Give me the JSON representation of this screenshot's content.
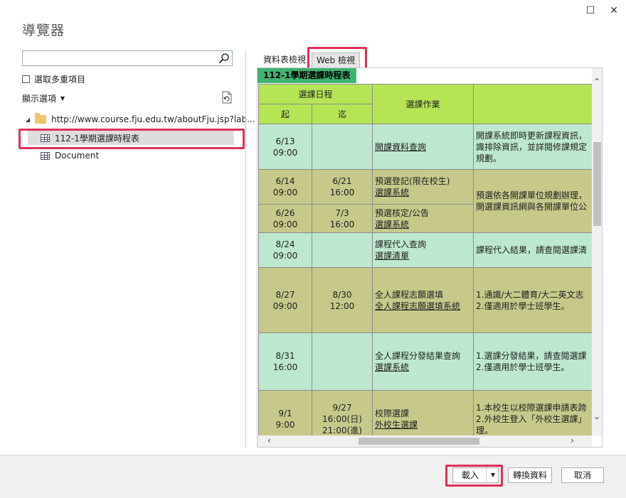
{
  "window": {
    "title": "導覽器",
    "restore_glyph": "☐",
    "close_glyph": "✕"
  },
  "left": {
    "search_placeholder": "",
    "multi_select_label": "選取多重項目",
    "display_options_label": "顯示選項",
    "tree": {
      "root_label": "http://www.course.fju.edu.tw/aboutFju.jsp?lab...",
      "items": [
        {
          "label": "112-1學期選課時程表",
          "selected": true
        },
        {
          "label": "Document",
          "selected": false
        }
      ]
    }
  },
  "right": {
    "tabs": [
      {
        "label": "資料表檢視",
        "active": false
      },
      {
        "label": "Web 檢視",
        "active": true
      }
    ],
    "caption": "112-1學期選課時程表",
    "table": {
      "header": {
        "schedule": "選課日程",
        "start": "起",
        "end": "迄",
        "task": "選課作業",
        "desc": ""
      },
      "rows": [
        {
          "start": [
            "6/13",
            "09:00"
          ],
          "end": [
            "",
            ""
          ],
          "task": [
            "開課資料查詢"
          ],
          "task_links": [
            true
          ],
          "desc": [
            "開課系統即時更新課程資訊，",
            "識排除資訊，並詳閱修課規定",
            "規劃。"
          ],
          "tone": "A"
        },
        {
          "start": [
            "6/14",
            "09:00"
          ],
          "end": [
            "6/21",
            "16:00"
          ],
          "task": [
            "預選登記(限在校生)",
            "選課系統"
          ],
          "task_links": [
            false,
            true
          ],
          "desc": [
            "",
            "預選依各開課單位規劃辦理，",
            "開選課資訊網與各開課單位公"
          ],
          "tone": "B"
        },
        {
          "start": [
            "6/26",
            "09:00"
          ],
          "end": [
            "7/3",
            "16:00"
          ],
          "task": [
            "預選核定/公告",
            "選課系統"
          ],
          "task_links": [
            false,
            true
          ],
          "desc": [],
          "tone": "B"
        },
        {
          "start": [
            "8/24",
            "09:00"
          ],
          "end": [
            "",
            ""
          ],
          "task": [
            "課程代入查詢",
            "選課清單"
          ],
          "task_links": [
            false,
            true
          ],
          "desc": [
            "課程代入結果，請查閱選課清"
          ],
          "tone": "A"
        },
        {
          "start": [
            "8/27",
            "09:00"
          ],
          "end": [
            "8/30",
            "12:00"
          ],
          "task": [
            "全人課程志願選填",
            "全人課程志願選填系統"
          ],
          "task_links": [
            false,
            true
          ],
          "desc": [
            "1.通識/大二體育/大二英文志",
            "2.僅適用於學士班學生。"
          ],
          "tone": "B"
        },
        {
          "start": [
            "8/31",
            "16:00"
          ],
          "end": [
            "",
            ""
          ],
          "task": [
            "全人課程分發結果查詢",
            "選課系統"
          ],
          "task_links": [
            false,
            true
          ],
          "desc": [
            "1.選課分發結果，請查閱選課",
            "2.僅適用於學士班學生。"
          ],
          "tone": "A"
        },
        {
          "start": [
            "9/1",
            "9:00"
          ],
          "end": [
            "9/27",
            "16:00(日)",
            "21:00(進)"
          ],
          "task": [
            "校際選課",
            "外校生選課"
          ],
          "task_links": [
            false,
            true
          ],
          "desc": [
            "1.本校生以校際選課申請表跨",
            "2.外校生登入「外校生選課」",
            "理。"
          ],
          "tone": "B"
        }
      ]
    }
  },
  "footer": {
    "load_label": "載入",
    "transform_label": "轉換資料",
    "cancel_label": "取消"
  },
  "colors": {
    "highlight": "#e0305a",
    "caption_bg": "#3fb36f",
    "header_bg": "#b5e555",
    "row_light": "#bde8cf",
    "row_olive": "#c6c98a"
  }
}
